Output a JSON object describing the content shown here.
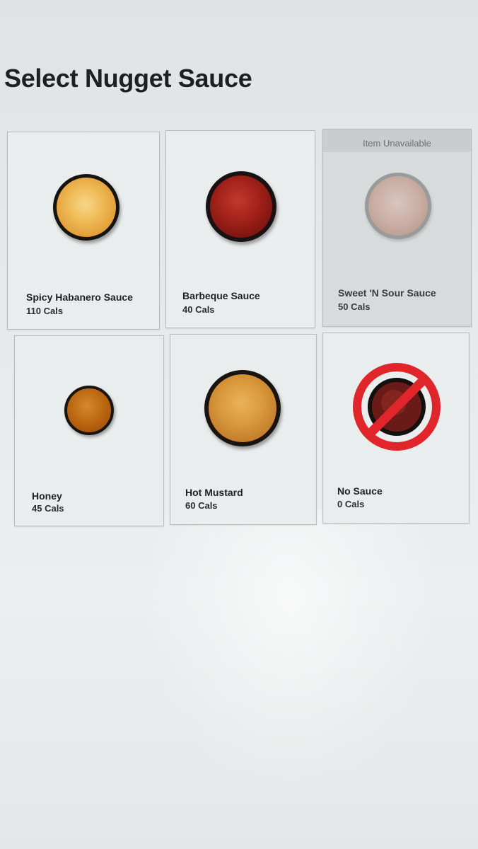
{
  "page": {
    "title": "Select Nugget Sauce"
  },
  "sauces": [
    {
      "name": "Spicy Habanero Sauce",
      "cals": "110 Cals",
      "available": true,
      "color": "#e8a43a"
    },
    {
      "name": "Barbeque Sauce",
      "cals": "40 Cals",
      "available": true,
      "color": "#8e1a14"
    },
    {
      "name": "Sweet 'N Sour Sauce",
      "cals": "50 Cals",
      "available": false,
      "status": "Item Unavailable",
      "color": "#c9a79a"
    },
    {
      "name": "Honey",
      "cals": "45 Cals",
      "available": true,
      "color": "#b8620f"
    },
    {
      "name": "Hot Mustard",
      "cals": "60 Cals",
      "available": true,
      "color": "#c9842a"
    },
    {
      "name": "No Sauce",
      "cals": "0 Cals",
      "available": true,
      "icon": "no-sauce-icon",
      "color": "#e0262b"
    }
  ]
}
